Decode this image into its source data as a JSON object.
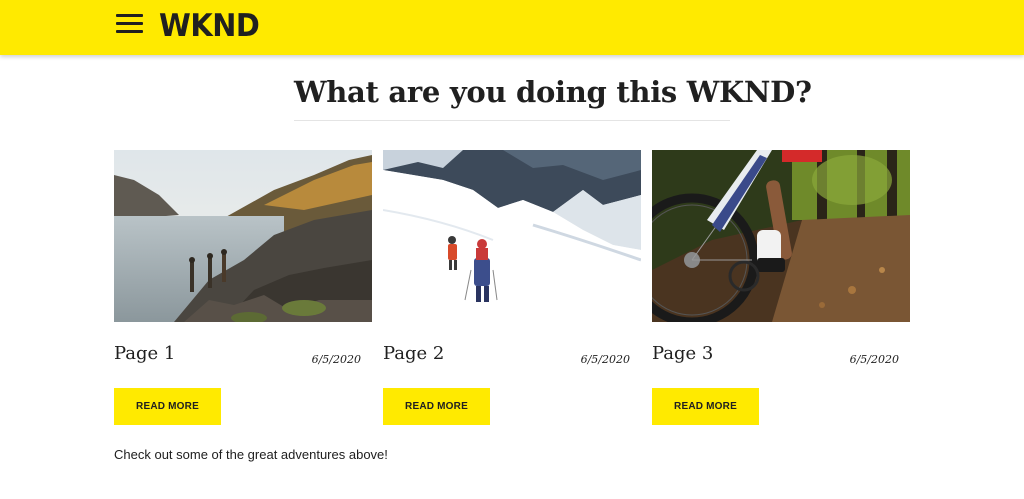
{
  "header": {
    "menu_icon": "hamburger-menu-icon",
    "logo_text": "WKND",
    "background_color": "#ffea00"
  },
  "main": {
    "headline": "What are you doing this WKND?",
    "cards": [
      {
        "title": "Page 1",
        "date": "6/5/2020",
        "button_label": "READ MORE",
        "image_subject": "hikers on rocky lakeshore"
      },
      {
        "title": "Page 2",
        "date": "6/5/2020",
        "button_label": "READ MORE",
        "image_subject": "climbers on snowy glacier"
      },
      {
        "title": "Page 3",
        "date": "6/5/2020",
        "button_label": "READ MORE",
        "image_subject": "mountain biker on forest trail"
      }
    ],
    "footer_text": "Check out some of the great adventures above!"
  },
  "colors": {
    "accent": "#ffea00",
    "text": "#202020"
  }
}
